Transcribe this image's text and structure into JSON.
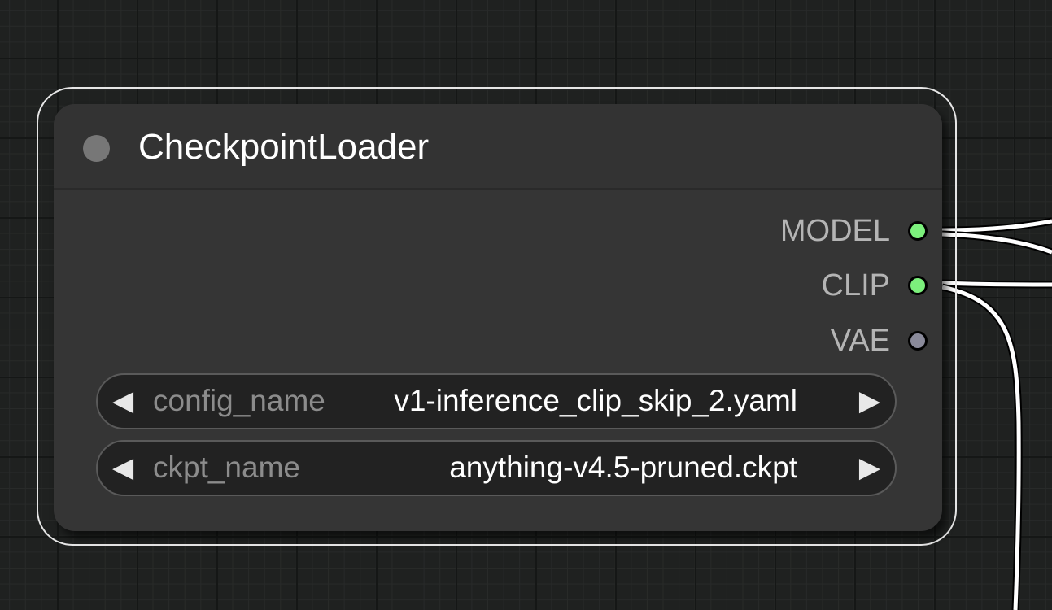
{
  "node": {
    "title": "CheckpointLoader",
    "outputs": [
      {
        "label": "MODEL",
        "color": "#7cf07c"
      },
      {
        "label": "CLIP",
        "color": "#7cf07c"
      },
      {
        "label": "VAE",
        "color": "#8a8a9a"
      }
    ],
    "widgets": [
      {
        "name": "config_name",
        "value": "v1-inference_clip_skip_2.yaml"
      },
      {
        "name": "ckpt_name",
        "value": "anything-v4.5-pruned.ckpt"
      }
    ]
  },
  "icons": {
    "left": "◀",
    "right": "▶"
  },
  "colors": {
    "canvas": "#1f2120",
    "node_body": "#353535",
    "selection": "#e6e6e6",
    "wire": "#ffffff"
  }
}
